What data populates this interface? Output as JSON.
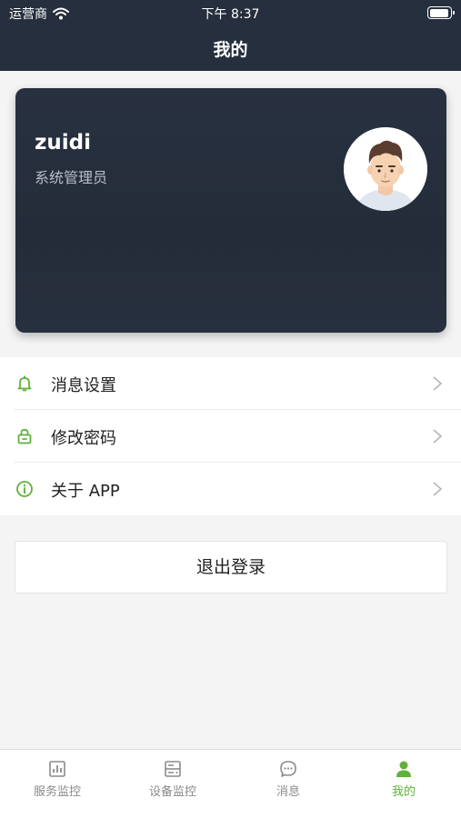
{
  "status_bar": {
    "carrier": "运营商",
    "time": "下午 8:37"
  },
  "nav": {
    "title": "我的"
  },
  "profile": {
    "name": "zuidi",
    "role": "系统管理员"
  },
  "menu": {
    "items": [
      {
        "label": "消息设置",
        "icon": "bell-icon"
      },
      {
        "label": "修改密码",
        "icon": "lock-icon"
      },
      {
        "label": "关于 APP",
        "icon": "info-icon"
      }
    ]
  },
  "logout": {
    "label": "退出登录"
  },
  "tabs": {
    "items": [
      {
        "label": "服务监控",
        "icon": "bar-chart-icon",
        "active": false
      },
      {
        "label": "设备监控",
        "icon": "device-list-icon",
        "active": false
      },
      {
        "label": "消息",
        "icon": "chat-bubble-icon",
        "active": false
      },
      {
        "label": "我的",
        "icon": "person-icon",
        "active": true
      }
    ]
  },
  "colors": {
    "header_bg": "#262f3d",
    "accent": "#5fb23a",
    "page_bg": "#f4f4f5"
  }
}
